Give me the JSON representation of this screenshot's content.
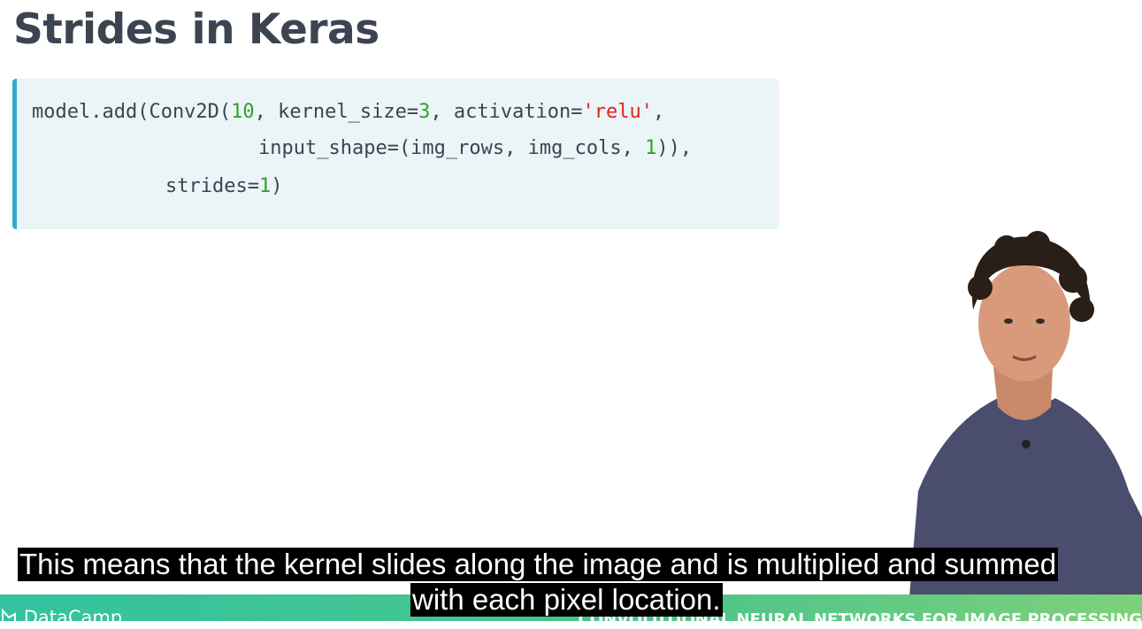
{
  "slide": {
    "title": "Strides in Keras"
  },
  "code": {
    "line1": {
      "p1": "model.add(Conv2D(",
      "n1": "10",
      "p2": ", kernel_size=",
      "n2": "3",
      "p3": ", activation=",
      "s1": "'relu'",
      "p4": ","
    },
    "line2": {
      "p1": "input_shape=(img_rows, img_cols, ",
      "n1": "1",
      "p2": ")),"
    },
    "line3": {
      "p1": "strides=",
      "n1": "1",
      "p2": ")"
    }
  },
  "captions": {
    "line1": "This means that the kernel slides along the image and is multiplied and summed",
    "line2": "with each pixel location."
  },
  "footer": {
    "brand": "DataCamp",
    "course": "CONVOLUTIONAL NEURAL NETWORKS FOR IMAGE PROCESSING",
    "brand_logo_icon": "datacamp-logo-icon"
  },
  "colors": {
    "title": "#3d4451",
    "code_bg": "#ebf4f7",
    "code_accent": "#33aacc",
    "number": "#33a02c",
    "string": "#e0251b",
    "footer_green": "#4cc48a"
  }
}
